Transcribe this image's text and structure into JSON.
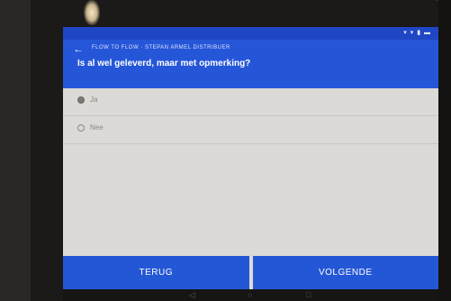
{
  "status": {
    "icons_text": "▾ ▾ ▮ ▬"
  },
  "header": {
    "breadcrumb": "FLOW TO FLOW · STEPAN ARMEL DISTRIBUER",
    "question": "Is al wel geleverd, maar met opmerking?"
  },
  "options": [
    {
      "label": "Ja",
      "checked": true
    },
    {
      "label": "Nee",
      "checked": false
    }
  ],
  "footer": {
    "back_label": "TERUG",
    "next_label": "VOLGENDE"
  },
  "colors": {
    "appbar": "#2656d8",
    "statusbar": "#1f46c4",
    "button": "#2457d6",
    "screen_bg": "#dcdad6"
  },
  "icons": {
    "back": "arrow-left-icon",
    "nav_back": "triangle-back-icon",
    "nav_home": "circle-home-icon",
    "nav_recent": "square-recent-icon"
  }
}
